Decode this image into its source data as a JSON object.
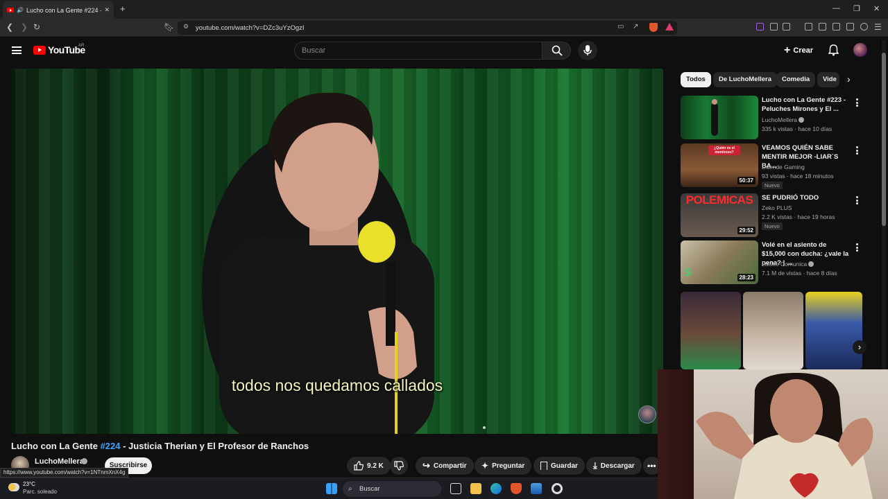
{
  "browser": {
    "tab_title": "Lucho con La Gente #224 - Ju",
    "url": "youtube.com/watch?v=DZc3uYzOgzI",
    "new_tab_symbol": "+",
    "close_symbol": "✕"
  },
  "header": {
    "logo_text": "YouTube",
    "country_code": "AR",
    "search_placeholder": "Buscar",
    "create_label": "Crear"
  },
  "video": {
    "subtitle": "todos nos quedamos callados",
    "title_prefix": "Lucho con La Gente ",
    "title_hashtag": "#224",
    "title_suffix": " - Justicia Therian y El Profesor de Ranchos",
    "channel_name": "LuchoMellera",
    "subscribe_label": "Suscribirse",
    "likes": "9.2 K",
    "share_label": "Compartir",
    "ask_label": "Preguntar",
    "save_label": "Guardar",
    "download_label": "Descargar"
  },
  "status_link": "https://www.youtube.com/watch?v=1NTnmXnX4g",
  "sidebar": {
    "chips": [
      "Todos",
      "De LuchoMellera",
      "Comedia",
      "Vide"
    ],
    "recommendations": [
      {
        "title": "Lucho con La Gente #223 - Peluches Mirones y El ...",
        "channel": "LuchoMellera",
        "meta": "335 k vistas · hace 10 días",
        "duration": "",
        "badge": ""
      },
      {
        "title": "VEAMOS QUIÉN SABE MENTIR MEJOR -LIAR´S BA...",
        "channel": "Duende Gaming",
        "meta": "93 vistas · hace 18 minutos",
        "duration": "50:37",
        "badge": "Nuevo"
      },
      {
        "title": "SE PUDRIÓ TODO",
        "channel": "Zeko PLUS",
        "meta": "2.2 K vistas · hace 19 horas",
        "duration": "29:52",
        "badge": "Nuevo"
      },
      {
        "title": "Volé en el asiento de $15,000 con ducha: ¿vale la pena? | ...",
        "channel": "Luisito Comunica",
        "meta": "7.1 M de vistas · hace 8 días",
        "duration": "28:23",
        "badge": ""
      }
    ],
    "thumb_texts": {
      "thumb2": "¿Quién es el mentiroso?",
      "thumb3": "POLEMICAS"
    }
  },
  "taskbar": {
    "weather_temp": "23°C",
    "weather_desc": "Parc. soleado",
    "search_label": "Buscar"
  },
  "colors": {
    "accent": "#ff0000",
    "link": "#3ea6ff",
    "background": "#0f0f0f"
  }
}
